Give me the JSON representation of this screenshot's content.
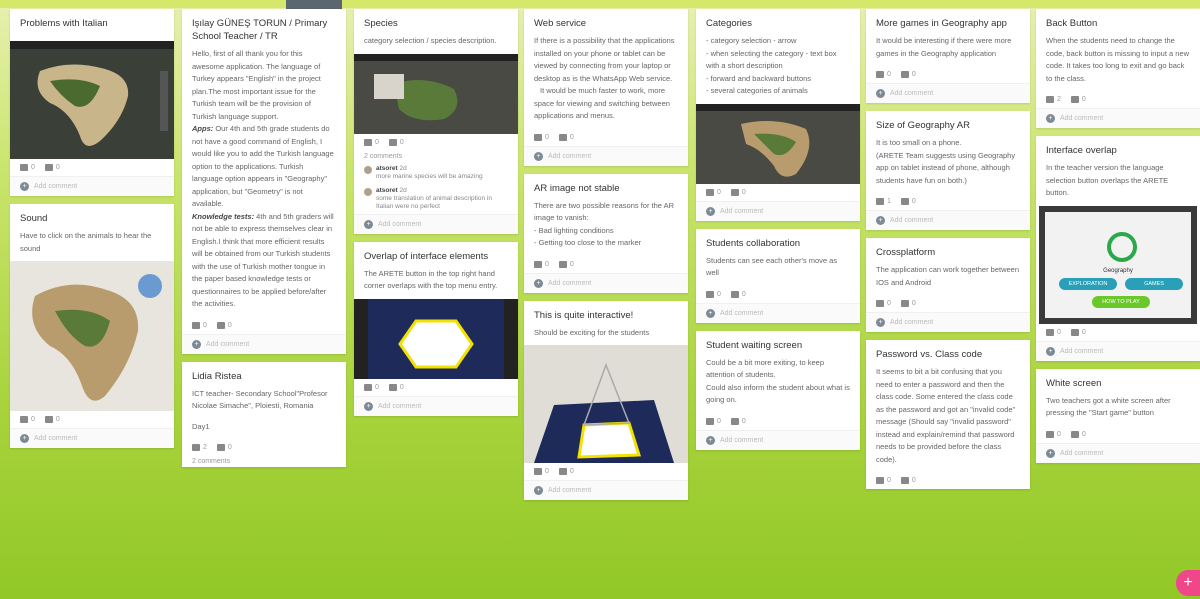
{
  "board": {
    "add_button": "+"
  },
  "reactions": {
    "like": "0",
    "dislike": "0",
    "add_comment": "Add comment"
  },
  "columns": [
    {
      "cards": [
        {
          "title": "Problems with Italian",
          "text": []
        },
        {
          "title": "Sound",
          "text": [
            "Have to click on the animals to hear the sound"
          ]
        }
      ]
    },
    {
      "cards": [
        {
          "title": "Işılay GÜNEŞ TORUN / Primary School Teacher / TR",
          "text": [
            "Hello, first of all thank you for this awesome application. The language of Turkey appears \"English\" in the project plan.The most important issue for the Turkish team will be the provision of Turkish language support.",
            "Apps: Our 4th and 5th grade students do not have a good command of English, I would like you to add the Turkish language option to the applications. Turkish language option appears in \"Geography\" application, but \"Geometry\" is not available.",
            "Knowledge tests: 4th and 5th graders will not be able to express themselves clear in English.I think that more efficient results will be obtained from our Turkish students with the use of Turkish mother tongue in the paper based knowledge tests or questionnaires to be applied before/after the activities."
          ]
        },
        {
          "title": "Lidia Ristea",
          "text": [
            "ICT teacher- Secondary School\"Profesor Nicolae Simache\", Ploiesti, Romania",
            "Day1"
          ],
          "likes": "2",
          "comments_count": "2 comments"
        }
      ]
    },
    {
      "cards": [
        {
          "title": "Species",
          "text": [
            "category selection / species description."
          ],
          "comments_count": "2 comments",
          "comments": [
            {
              "name": "atsoret",
              "when": "2d",
              "text": "more marine species will be amazing"
            },
            {
              "name": "atsoret",
              "when": "2d",
              "text": "some translation of animal description in Italian were no perfect"
            }
          ]
        },
        {
          "title": "Overlap of interface elements",
          "text": [
            "The ARETE button in the top right hand corner overlaps with the top menu entry."
          ]
        }
      ]
    },
    {
      "cards": [
        {
          "title": "Web service",
          "text": [
            "If there is a possibility that the applications installed on your phone or tablet can be viewed by connecting from your laptop or desktop as is the WhatsApp Web service.",
            "It would be much faster to work, more space for viewing and switching between applications and menus."
          ]
        },
        {
          "title": "AR image not stable",
          "text": [
            "There are two possible reasons for the AR image to vanish:",
            "- Bad lighting conditions",
            "- Getting too close to the marker"
          ]
        },
        {
          "title": "This is quite interactive!",
          "text": [
            "Should be exciting for the students"
          ]
        }
      ]
    },
    {
      "cards": [
        {
          "title": "Categories",
          "text": [
            "- category selection - arrow",
            "- when selecting the category - text box with a short description",
            "- forward and backward buttons",
            "- several categories of animals"
          ]
        },
        {
          "title": "Students collaboration",
          "text": [
            "Students can see each other's move as well"
          ]
        },
        {
          "title": "Student waiting screen",
          "text": [
            "Could be a bit more exiting, to keep attention of students.",
            "Could also inform the student about what is going on."
          ]
        }
      ]
    },
    {
      "cards": [
        {
          "title": "More games in Geography app",
          "text": [
            "It would be interesting if there were more games in the Geography application"
          ]
        },
        {
          "title": "Size of Geography AR",
          "text": [
            "It is too small on a phone.",
            "(ARETE Team suggests using Geography app on tablet instead of phone, although students have fun on both.)"
          ],
          "likes": "1"
        },
        {
          "title": "Crossplatform",
          "text": [
            "The application can work together between IOS and Android"
          ]
        },
        {
          "title": "Password vs. Class code",
          "text": [
            "It seems to bit a bit confusing that you need to enter a password and then the class code. Some entered the class code as the password and got an \"invalid code\" message (Should say \"invalid password\" instead and explain/remind that password needs to be provided before the class code)."
          ]
        }
      ]
    },
    {
      "cards": [
        {
          "title": "Back Button",
          "text": [
            "When the students need to change the code, back button is missing to input a new code. It takes too long to exit and go back to the class."
          ],
          "likes": "2"
        },
        {
          "title": "Interface overlap",
          "text": [
            "In the teacher version the language selection button overlaps the ARETE button."
          ],
          "img_labels": [
            "Geography",
            "EXPLORATION",
            "GAMES",
            "HOW TO PLAY"
          ]
        },
        {
          "title": "White screen",
          "text": [
            "Two teachers got a white screen after pressing the \"Start game\" button"
          ]
        }
      ]
    }
  ],
  "colors": {
    "accent": "#f0468a",
    "bg": "#a6d23a"
  }
}
